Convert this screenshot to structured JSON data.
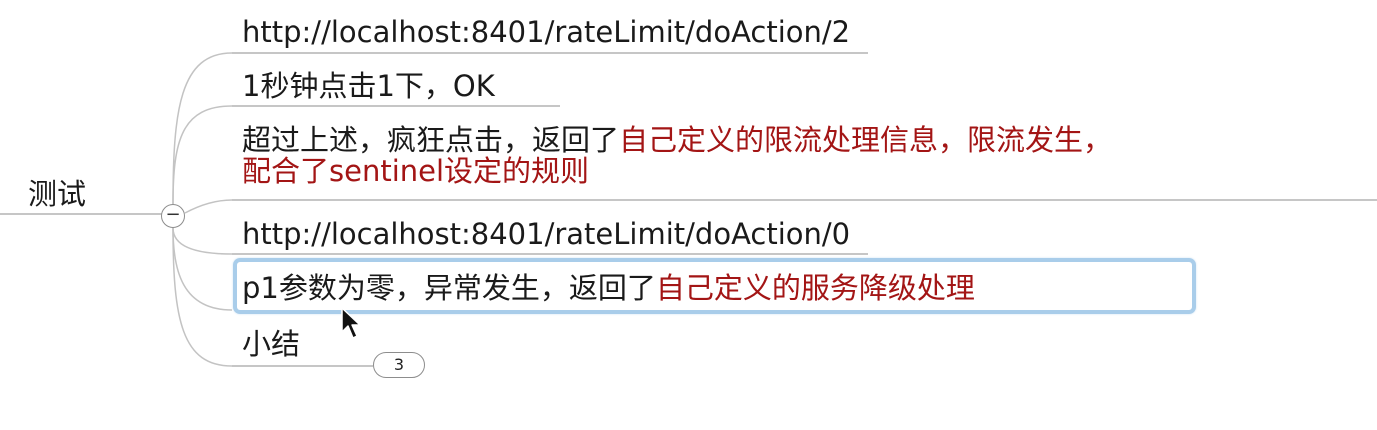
{
  "root": {
    "label": "测试"
  },
  "children": [
    {
      "text": "http://localhost:8401/rateLimit/doAction/2"
    },
    {
      "text": "1秒钟点击1下，OK"
    },
    {
      "text_black": "超过上述，疯狂点击，返回了",
      "text_red_line1": "自己定义的限流处理信息，限流发生，",
      "text_red_line2": "配合了sentinel设定的规则"
    },
    {
      "text": "http://localhost:8401/rateLimit/doAction/0"
    },
    {
      "text_black": "p1参数为零，异常发生，返回了",
      "text_red": "自己定义的服务降级处理"
    },
    {
      "text": "小结",
      "collapsed_count": "3"
    }
  ],
  "collapse_symbol": "−",
  "colors": {
    "text": "#1a1a1a",
    "highlight_text": "#a31515",
    "connector": "#b4b4b4",
    "selection": "#a9cdea"
  },
  "icons": {
    "collapse": "minus-circle-icon",
    "cursor": "arrow-pointer-icon"
  }
}
